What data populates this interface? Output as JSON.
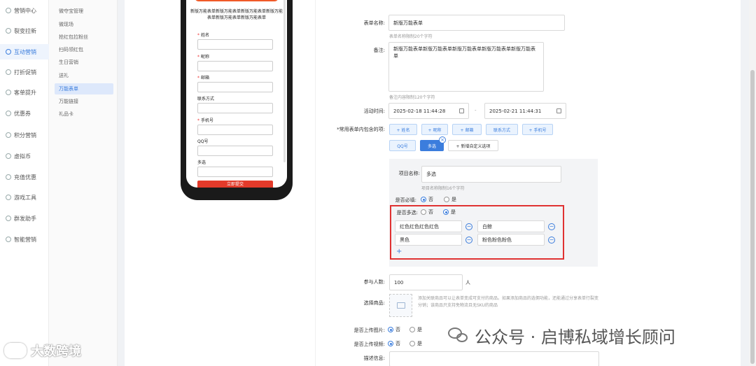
{
  "sidebar": {
    "items": [
      {
        "label": "营销中心",
        "active": false
      },
      {
        "label": "裂变拉新",
        "active": false
      },
      {
        "label": "互动营销",
        "active": true
      },
      {
        "label": "打折促销",
        "active": false
      },
      {
        "label": "客单提升",
        "active": false
      },
      {
        "label": "优惠券",
        "active": false
      },
      {
        "label": "积分营销",
        "active": false
      },
      {
        "label": "虚拟币",
        "active": false
      },
      {
        "label": "充值优惠",
        "active": false
      },
      {
        "label": "游戏工具",
        "active": false
      },
      {
        "label": "群发助手",
        "active": false
      },
      {
        "label": "智能营销",
        "active": false
      }
    ]
  },
  "subnav": {
    "items": [
      {
        "label": "微夺宝管理",
        "active": false
      },
      {
        "label": "微现场",
        "active": false
      },
      {
        "label": "抢红包拉粉丝",
        "active": false
      },
      {
        "label": "扫码领红包",
        "active": false
      },
      {
        "label": "生日营销",
        "active": false
      },
      {
        "label": "送礼",
        "active": false
      },
      {
        "label": "万能表单",
        "active": true
      },
      {
        "label": "万能链接",
        "active": false
      },
      {
        "label": "礼品卡",
        "active": false
      }
    ]
  },
  "preview": {
    "description": "新版万能表单新版万能表单新版万能表单新版万能表单新版万能表单新版万能表单",
    "fields": [
      {
        "label": "姓名",
        "required": true
      },
      {
        "label": "昵称",
        "required": true
      },
      {
        "label": "邮箱",
        "required": true
      },
      {
        "label": "联系方式",
        "required": false
      },
      {
        "label": "手机号",
        "required": true
      },
      {
        "label": "QQ号",
        "required": false
      },
      {
        "label": "多选",
        "required": false
      }
    ],
    "submit_label": "立即提交"
  },
  "form": {
    "name_label": "表单名称:",
    "name_value": "新版万能表单",
    "name_hint": "表单名称限制20个字符",
    "remark_label": "备注:",
    "remark_value": "新版万能表单新版万能表单新版万能表单新版万能表单新版万能表单",
    "remark_hint": "备注内容限制120个字符",
    "time_label": "活动时间:",
    "start_time": "2025-02-18 11:44:28",
    "end_time": "2025-02-21 11:44:31",
    "time_separator": "-",
    "items_label": "*常用表单内包含的项:",
    "tags": [
      {
        "label": "+ 姓名",
        "selected": false
      },
      {
        "label": "+ 昵称",
        "selected": false
      },
      {
        "label": "+ 邮箱",
        "selected": false
      },
      {
        "label": "联系方式",
        "selected": false
      },
      {
        "label": "+ 手机号",
        "selected": false
      },
      {
        "label": "QQ号",
        "selected": false
      },
      {
        "label": "多选",
        "selected": true
      }
    ],
    "tag_close": "×",
    "add_custom_label": "+ 新增自定义选项",
    "item_name_label": "项目名称:",
    "item_name_value": "多选",
    "item_name_hint": "项目名称限制16个字符",
    "required_label": "是否必填:",
    "required_no": "否",
    "required_yes": "是",
    "multi_label": "是否多选:",
    "multi_no": "否",
    "multi_yes": "是",
    "options": [
      "红色红色红色红色",
      "白鲸",
      "黑色",
      "粉色粉色粉色"
    ],
    "minus": "−",
    "plus": "+",
    "participants_label": "参与人数:",
    "participants_value": "100",
    "participants_unit": "人",
    "goods_label": "选择商品:",
    "goods_hint": "添加关联商品可以让表单变成可支付的商品。如果添加商品的选佣功能，还能通过分享表单行裂变分销；该商品只支持免物流且无SKU的商品",
    "upload_image_label": "是否上传图片:",
    "upload_image_no": "否",
    "upload_image_yes": "是",
    "upload_video_label": "是否上传视频:",
    "upload_video_no": "否",
    "upload_video_yes": "是",
    "desc_label": "描述信息:"
  },
  "watermarks": {
    "left": "大数跨境",
    "right": "公众号 · 启博私域增长顾问"
  },
  "colors": {
    "accent": "#3b7ddd",
    "highlight_border": "#e03232",
    "submit": "#e33a2a"
  }
}
